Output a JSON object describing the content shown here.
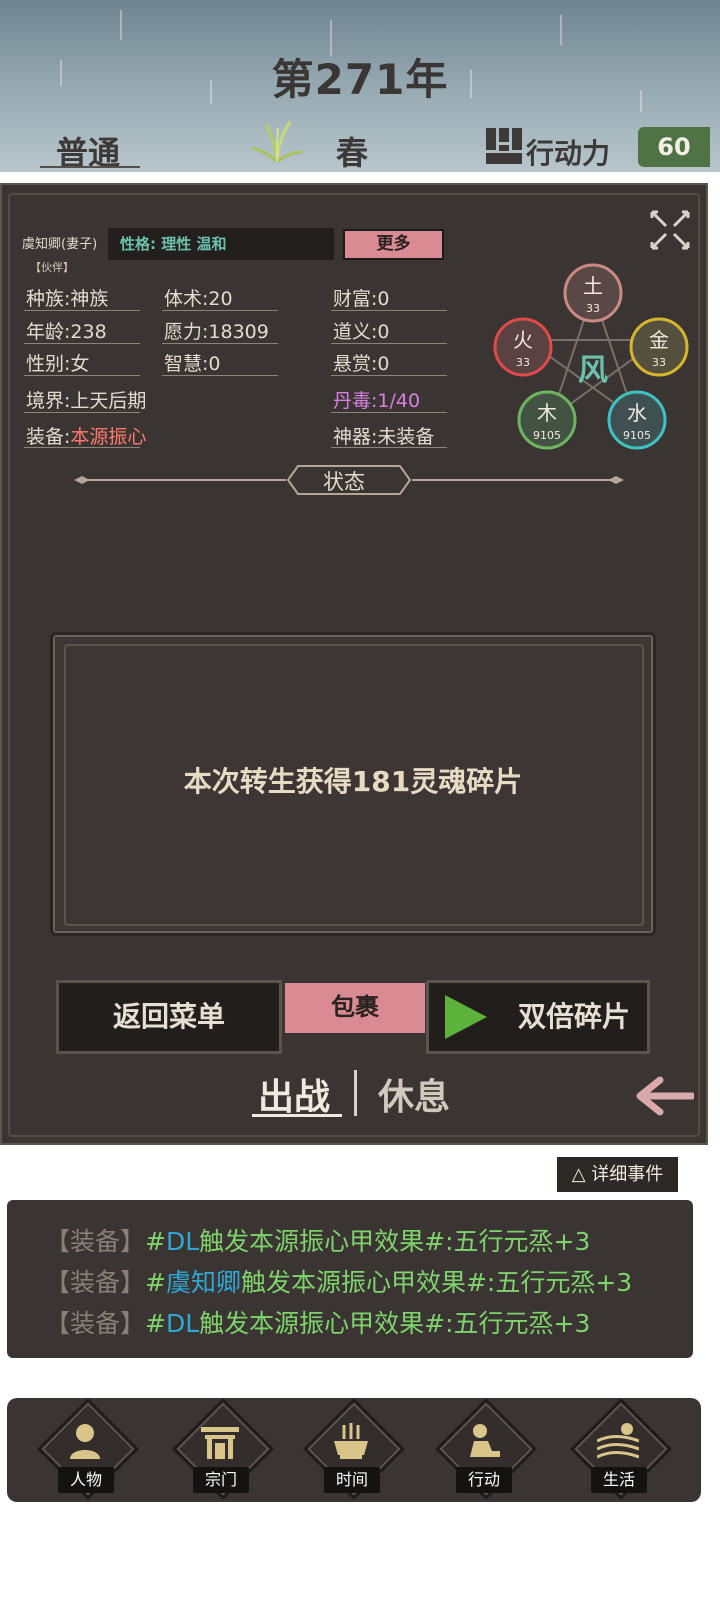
{
  "header": {
    "year": "第271年",
    "difficulty": "普通",
    "season": "春",
    "action_label": "行动力",
    "action_value": "60"
  },
  "character": {
    "name": "虞知卿(妻子)",
    "sub": "【伙伴】",
    "personality": "性格: 理性 温和",
    "more_button": "更多",
    "stats": {
      "race": "种族:神族",
      "body": "体术:20",
      "wealth": "财富:0",
      "age": "年龄:238",
      "wish": "愿力:18309",
      "morality": "道义:0",
      "gender": "性别:女",
      "wisdom": "智慧:0",
      "bounty": "悬赏:0",
      "realm": "境界:上天后期",
      "poison": "丹毒:1/40",
      "equip_label": "装备:",
      "equip_value": "本源振心",
      "artifact": "神器:未装备"
    },
    "elements": {
      "center": "风",
      "earth": {
        "name": "土",
        "value": "33"
      },
      "fire": {
        "name": "火",
        "value": "33"
      },
      "metal": {
        "name": "金",
        "value": "33"
      },
      "wood": {
        "name": "木",
        "value": "9105"
      },
      "water": {
        "name": "水",
        "value": "9105"
      }
    },
    "status_label": "状态"
  },
  "dialog": {
    "message": "本次转生获得181灵魂碎片"
  },
  "buttons": {
    "back": "返回菜单",
    "bag": "包裹",
    "double": "双倍碎片"
  },
  "tabs": {
    "battle": "出战",
    "rest": "休息"
  },
  "log": {
    "detail_button": "△ 详细事件",
    "lines": [
      {
        "tag": "【装备】",
        "hash": "#",
        "actor": "DL",
        "rest": "触发本源振心甲效果#:五行元烝+3"
      },
      {
        "tag": "【装备】",
        "hash": "#",
        "actor": "虞知卿",
        "rest": "触发本源振心甲效果#:五行元烝+3"
      },
      {
        "tag": "【装备】",
        "hash": "#",
        "actor": "DL",
        "rest": "触发本源振心甲效果#:五行元烝+3"
      }
    ]
  },
  "nav": [
    {
      "label": "人物",
      "icon": "person-icon"
    },
    {
      "label": "宗门",
      "icon": "gate-icon"
    },
    {
      "label": "时间",
      "icon": "incense-icon"
    },
    {
      "label": "行动",
      "icon": "action-icon"
    },
    {
      "label": "生活",
      "icon": "landscape-icon"
    }
  ],
  "colors": {
    "accent_pink": "#d98a92",
    "panel": "#3a3432",
    "green": "#5cb23a",
    "actor_blue": "#2fa8d6"
  }
}
